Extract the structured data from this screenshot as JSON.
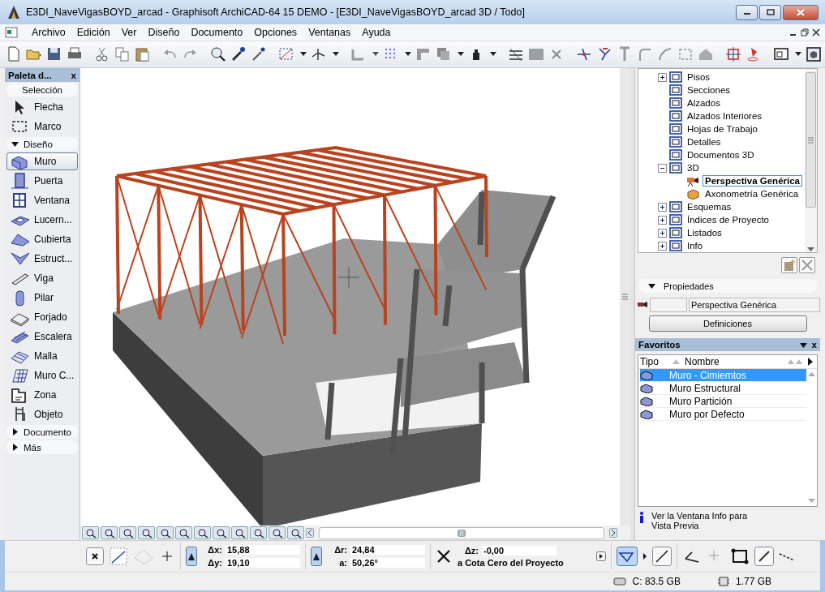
{
  "window": {
    "title": "E3DI_NaveVigasBOYD_arcad - Graphisoft ArchiCAD-64 15 DEMO - [E3DI_NaveVigasBOYD_arcad 3D / Todo]"
  },
  "menu": [
    "Archivo",
    "Edición",
    "Ver",
    "Diseño",
    "Documento",
    "Opciones",
    "Ventanas",
    "Ayuda"
  ],
  "toolbox": {
    "title": "Paleta d...",
    "close": "x",
    "sections": [
      {
        "label": "Selección",
        "kind": "plain",
        "tools": [
          {
            "label": "Flecha",
            "selected": false
          },
          {
            "label": "Marco",
            "selected": false
          }
        ]
      },
      {
        "label": "Diseño",
        "kind": "group",
        "expanded": true,
        "tools": [
          {
            "label": "Muro",
            "selected": true
          },
          {
            "label": "Puerta",
            "selected": false
          },
          {
            "label": "Ventana",
            "selected": false
          },
          {
            "label": "Lucern...",
            "selected": false
          },
          {
            "label": "Cubierta",
            "selected": false
          },
          {
            "label": "Estruct...",
            "selected": false
          },
          {
            "label": "Viga",
            "selected": false
          },
          {
            "label": "Pilar",
            "selected": false
          },
          {
            "label": "Forjado",
            "selected": false
          },
          {
            "label": "Escalera",
            "selected": false
          },
          {
            "label": "Malla",
            "selected": false
          },
          {
            "label": "Muro C...",
            "selected": false
          },
          {
            "label": "Zona",
            "selected": false
          },
          {
            "label": "Objeto",
            "selected": false
          }
        ]
      },
      {
        "label": "Documento",
        "kind": "group",
        "expanded": false
      },
      {
        "label": "Más",
        "kind": "group",
        "expanded": false
      }
    ]
  },
  "navigator": {
    "items": [
      {
        "label": "Pisos",
        "kind": "folder",
        "expanded": false,
        "selected": false
      },
      {
        "label": "Secciones",
        "kind": "leaf",
        "selected": false
      },
      {
        "label": "Alzados",
        "kind": "leaf",
        "selected": false
      },
      {
        "label": "Alzados Interiores",
        "kind": "leaf",
        "selected": false
      },
      {
        "label": "Hojas de Trabajo",
        "kind": "leaf",
        "selected": false
      },
      {
        "label": "Detalles",
        "kind": "leaf",
        "selected": false
      },
      {
        "label": "Documentos 3D",
        "kind": "leaf",
        "selected": false
      },
      {
        "label": "3D",
        "kind": "folder",
        "expanded": true,
        "selected": false,
        "children": [
          {
            "label": "Perspectiva Genérica",
            "kind": "leaf",
            "selected": true
          },
          {
            "label": "Axonometría Genérica",
            "kind": "leaf",
            "selected": false
          }
        ]
      },
      {
        "label": "Esquemas",
        "kind": "folder",
        "expanded": false,
        "selected": false
      },
      {
        "label": "Índices de Proyecto",
        "kind": "folder",
        "expanded": false,
        "selected": false
      },
      {
        "label": "Listados",
        "kind": "folder",
        "expanded": false,
        "selected": false
      },
      {
        "label": "Info",
        "kind": "folder",
        "expanded": false,
        "selected": false
      }
    ]
  },
  "properties": {
    "label": "Propiedades",
    "expanded": true,
    "name_value": "Perspectiva Genérica",
    "button": "Definiciones"
  },
  "favorites": {
    "title": "Favoritos",
    "close": "x",
    "columns": [
      "Tipo",
      "Nombre"
    ],
    "rows": [
      {
        "name": "Muro - Cimiemtos",
        "selected": true
      },
      {
        "name": "Muro Estructural",
        "selected": false
      },
      {
        "name": "Muro Partición",
        "selected": false
      },
      {
        "name": "Muro por Defecto",
        "selected": false
      }
    ],
    "info": "Ver la Ventana Info para Vista Previa"
  },
  "coordinates": {
    "cartesian": [
      {
        "label": "Δx:",
        "value": "15,88"
      },
      {
        "label": "Δy:",
        "value": "19,10"
      }
    ],
    "polar": [
      {
        "label": "Δr:",
        "value": "24,84"
      },
      {
        "label": "a:",
        "value": "50,26°"
      }
    ],
    "elevation": {
      "label": "Δz:",
      "value": "-0,00",
      "reference": "a Cota Cero del Proyecto"
    }
  },
  "status_bar": {
    "disk": "C: 83.5 GB",
    "memory": "1.77 GB"
  }
}
